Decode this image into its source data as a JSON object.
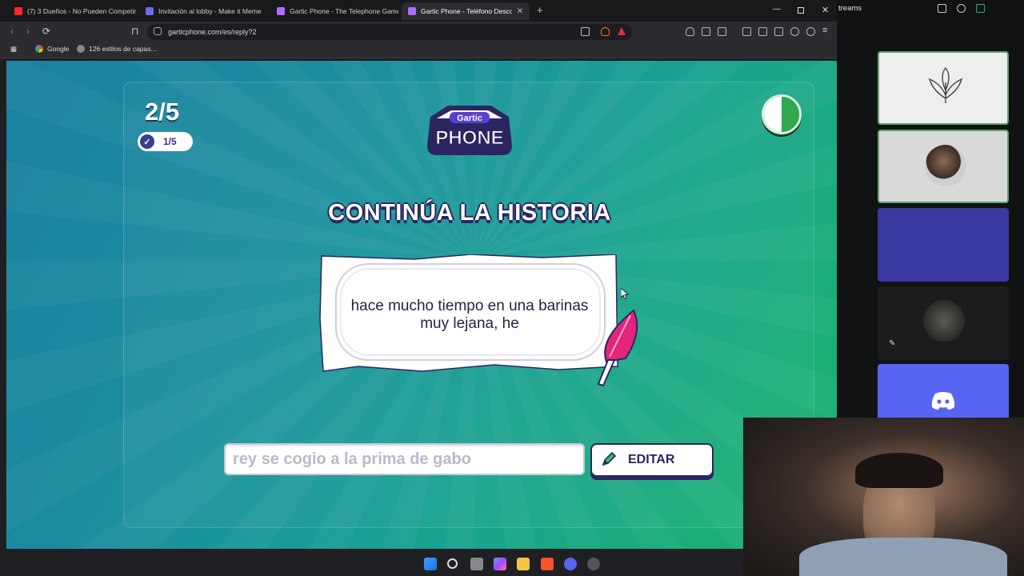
{
  "browser": {
    "tabs": [
      {
        "title": "(7) 3 Dueños - No Pueden Competir",
        "color": "#ff2a2a"
      },
      {
        "title": "Invitación al lobby - Make it Meme",
        "color": "#6a6af0"
      },
      {
        "title": "Gartic Phone - The Telephone Game",
        "color": "#b06cff"
      },
      {
        "title": "Gartic Phone - Teléfono Descom",
        "color": "#b06cff"
      }
    ],
    "url": "garticphone.com/es/reply?2",
    "bookmarks": [
      {
        "label": "Google"
      },
      {
        "label": "126 estilos de capas..."
      }
    ]
  },
  "game": {
    "round": "2/5",
    "done_count": "1/5",
    "logo_top": "Gartic",
    "logo_bottom": "PHONE",
    "heading": "CONTINÚA LA HISTORIA",
    "story_text": "hace mucho tiempo en una barinas muy lejana, he",
    "answer_value": "rey se cogio a la prima de gabo",
    "edit_label": "EDITAR",
    "timer_remaining": 0.5
  },
  "side": {
    "title": "treams"
  },
  "colors": {
    "accent": "#2b2660",
    "feather": "#e0257a",
    "discord": "#5865f2"
  }
}
